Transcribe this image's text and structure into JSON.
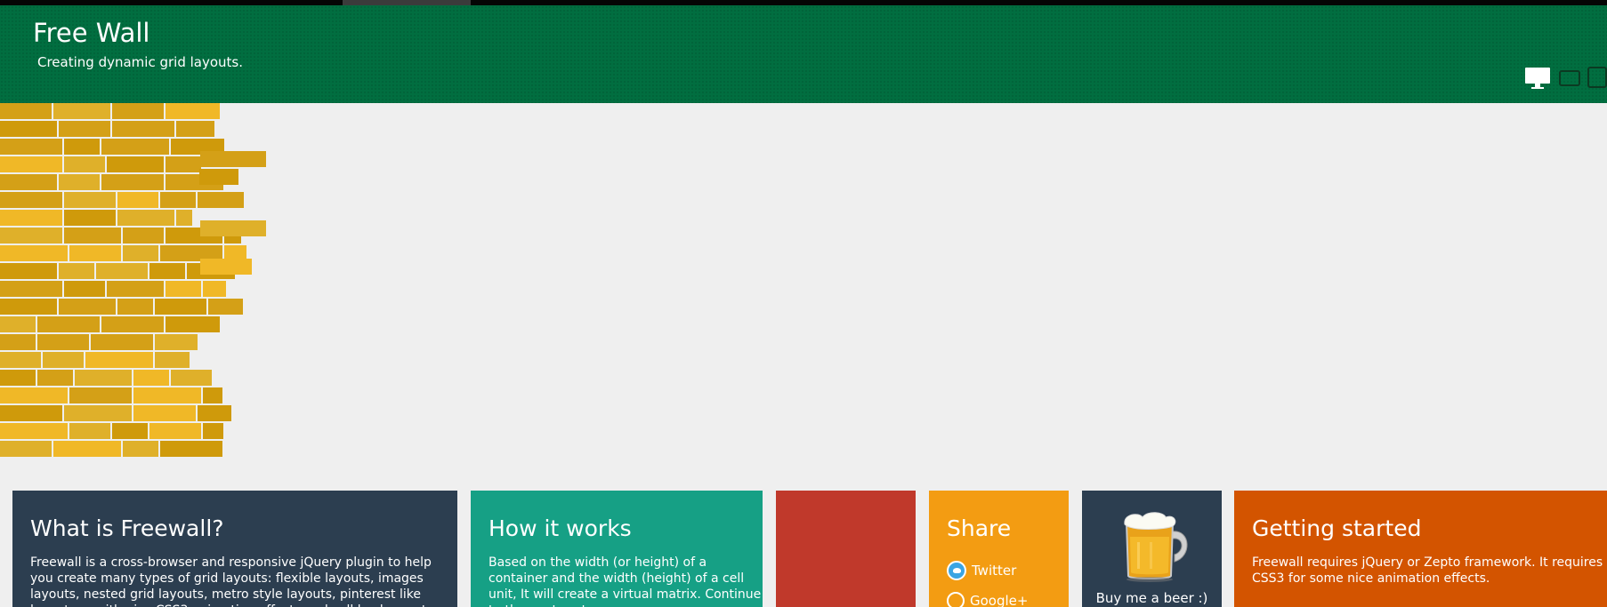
{
  "browser": {
    "tab_strip": "dark"
  },
  "header": {
    "title": "Free Wall",
    "subtitle": "Creating dynamic grid layouts.",
    "background": "#016e40",
    "devices": [
      {
        "name": "desktop",
        "icon": "desktop-icon",
        "active": true
      },
      {
        "name": "tablet",
        "icon": "tablet-landscape-icon",
        "active": false
      },
      {
        "name": "phone",
        "icon": "tablet-portrait-icon",
        "active": false
      }
    ]
  },
  "brick_colors": [
    "#d4a017",
    "#dfb02a",
    "#f0b827",
    "#cf9a0b"
  ],
  "cards": [
    {
      "title": "What is Freewall?",
      "body": "Freewall is a cross-browser and responsive jQuery plugin to help you create many types of grid layouts: flexible layouts, images layouts, nested grid layouts, metro style layouts, pinterest like layouts ... with nice CSS3 animation effects and call back events.",
      "color": "#2c3e50"
    },
    {
      "title": "How it works",
      "body": "Based on the width (or height) of a container and the width (height) of a cell unit, It will create a virtual matrix. Continue to the next part.",
      "color": "#16a085"
    },
    {
      "title": "",
      "body": "",
      "color": "#c0392b"
    },
    {
      "title": "Share",
      "links": [
        "Twitter",
        "Google+"
      ],
      "color": "#f39c12"
    },
    {
      "title": "",
      "beer_label": "Buy me a beer :)",
      "color": "#2c3e50"
    },
    {
      "title": "Getting started",
      "body": "Freewall requires jQuery or Zepto framework. It requires CSS3 for some nice animation effects.",
      "color": "#d35400"
    }
  ]
}
